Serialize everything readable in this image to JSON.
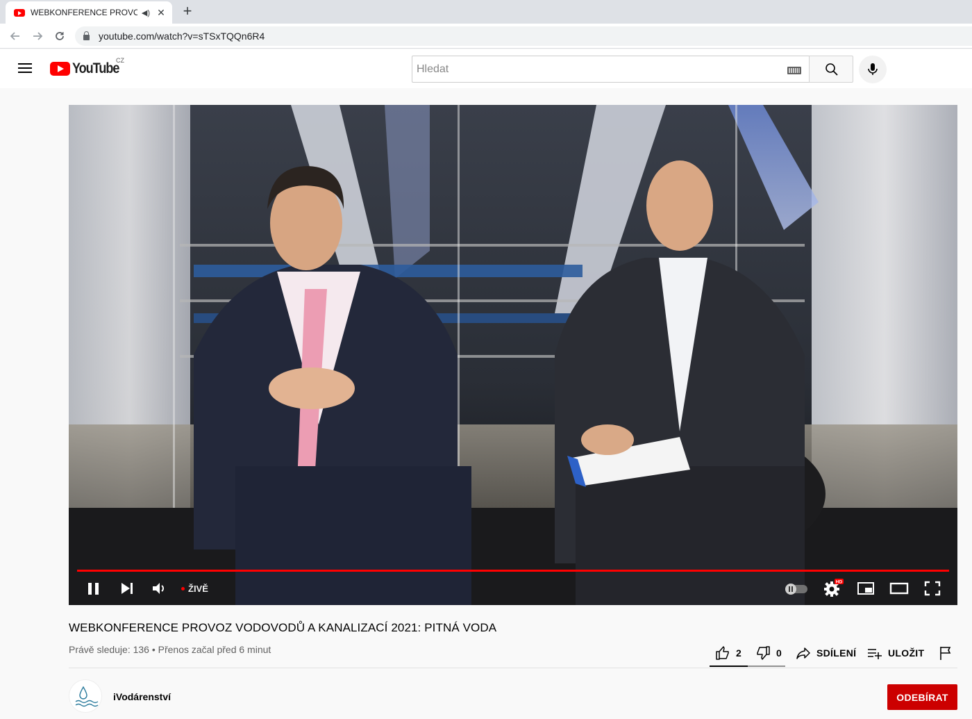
{
  "browser": {
    "tab_title": "WEBKONFERENCE PROVOZ VODOVODŮ A KANALIZACÍ 2021: PITNÁ VODA",
    "tab_close": "✕",
    "new_tab": "+",
    "url": "youtube.com/watch?v=sTSxTQQn6R4"
  },
  "header": {
    "logo_text": "YouTube",
    "country": "CZ",
    "search_placeholder": "Hledat"
  },
  "player": {
    "live_label": "ŽIVĚ",
    "hd_badge": "HD",
    "progress": 1.0
  },
  "video": {
    "title": "WEBKONFERENCE PROVOZ VODOVODŮ A KANALIZACÍ 2021: PITNÁ VODA",
    "meta": "Právě sleduje: 136 • Přenos začal před 6 minut",
    "likes": "2",
    "dislikes": "0",
    "share_label": "SDÍLENÍ",
    "save_label": "ULOŽIT"
  },
  "channel": {
    "name": "iVodárenství",
    "subscribe_label": "ODEBÍRAT"
  },
  "colors": {
    "brand_red": "#ff0000",
    "subscribe_red": "#cc0000"
  }
}
